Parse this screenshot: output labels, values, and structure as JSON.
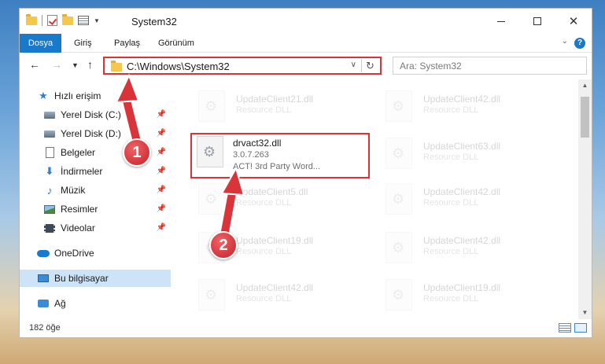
{
  "window": {
    "title": "System32",
    "controls": {
      "minimize": "minimize",
      "maximize": "maximize",
      "close": "close"
    }
  },
  "ribbon": {
    "tabs": [
      {
        "label": "Dosya",
        "active": true
      },
      {
        "label": "Giriş"
      },
      {
        "label": "Paylaş"
      },
      {
        "label": "Görünüm"
      }
    ],
    "help": "?"
  },
  "address": {
    "path": "C:\\Windows\\System32",
    "search_placeholder": "Ara: System32"
  },
  "sidebar": {
    "items": [
      {
        "label": "Hızlı erişim",
        "icon": "star-icon",
        "pinned": false
      },
      {
        "label": "Yerel Disk (C:)",
        "icon": "disk-icon",
        "pinned": true
      },
      {
        "label": "Yerel Disk (D:)",
        "icon": "disk-icon",
        "pinned": true
      },
      {
        "label": "Belgeler",
        "icon": "document-icon",
        "pinned": true
      },
      {
        "label": "İndirmeler",
        "icon": "download-icon",
        "pinned": true
      },
      {
        "label": "Müzik",
        "icon": "music-icon",
        "pinned": true
      },
      {
        "label": "Resimler",
        "icon": "pictures-icon",
        "pinned": true
      },
      {
        "label": "Videolar",
        "icon": "videos-icon",
        "pinned": true
      },
      {
        "label": "OneDrive",
        "icon": "cloud-icon",
        "pinned": false
      },
      {
        "label": "Bu bilgisayar",
        "icon": "computer-icon",
        "pinned": false,
        "selected": true
      },
      {
        "label": "Ağ",
        "icon": "network-icon",
        "pinned": false
      }
    ]
  },
  "files": {
    "left": [
      {
        "name": "UpdateClient21.dll",
        "desc": "Resource DLL"
      },
      {
        "name": "drvact32.dll",
        "version": "3.0.7.263",
        "desc": "ACT! 3rd Party Word...",
        "highlighted": true
      },
      {
        "name": "UpdateClient5.dll",
        "desc": "Resource DLL"
      },
      {
        "name": "UpdateClient19.dll",
        "desc": "Resource DLL"
      },
      {
        "name": "UpdateClient42.dll",
        "desc": "Resource DLL"
      }
    ],
    "right": [
      {
        "name": "UpdateClient42.dll",
        "desc": "Resource DLL"
      },
      {
        "name": "UpdateClient63.dll",
        "desc": "Resource DLL"
      },
      {
        "name": "UpdateClient42.dll",
        "desc": "Resource DLL"
      },
      {
        "name": "UpdateClient42.dll",
        "desc": "Resource DLL"
      },
      {
        "name": "UpdateClient19.dll",
        "desc": "Resource DLL"
      }
    ]
  },
  "status": {
    "count": "182 öğe"
  },
  "annotations": {
    "step1": "1",
    "step2": "2",
    "color": "#d9343a"
  },
  "colors": {
    "accent": "#1979ca",
    "highlight": "#d9343a",
    "selection": "#cde3f7"
  }
}
